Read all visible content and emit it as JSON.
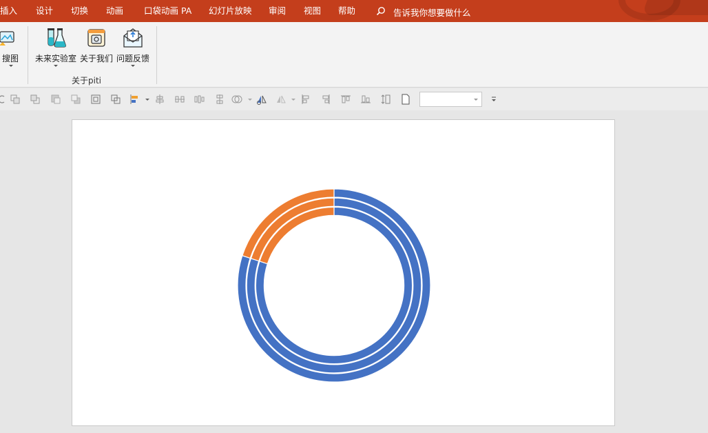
{
  "menu": {
    "items": [
      "插入",
      "设计",
      "切换",
      "动画",
      "口袋动画 PA",
      "幻灯片放映",
      "审阅",
      "视图",
      "帮助"
    ],
    "tell_me": "告诉我你想要做什么"
  },
  "ribbon": {
    "partial_button_label": "搜图",
    "buttons": [
      {
        "label": "未来实验室",
        "icon": "flask-icon"
      },
      {
        "label": "关于我们",
        "icon": "about-us-icon"
      },
      {
        "label": "问题反馈",
        "icon": "feedback-mail-icon"
      }
    ],
    "group_label": "关于piti"
  },
  "toolbar2": {
    "combo_value": ""
  },
  "colors": {
    "titlebar": "#c43e1c",
    "blue_series": "#4472c4",
    "orange_series": "#ed7d31"
  },
  "chart_data": {
    "type": "doughnut",
    "rings": 3,
    "series": [
      {
        "values": [
          80,
          20
        ]
      },
      {
        "values": [
          80,
          20
        ]
      },
      {
        "values": [
          80,
          20
        ]
      }
    ],
    "slice_colors": [
      "#4472c4",
      "#ed7d31"
    ]
  }
}
